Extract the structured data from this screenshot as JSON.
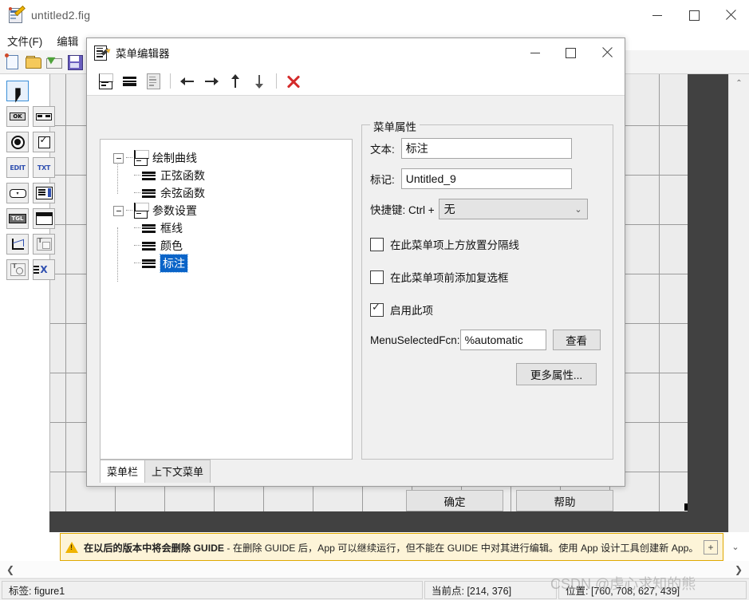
{
  "main_window": {
    "title": "untitled2.fig",
    "icon": "figure-file-icon",
    "controls": {
      "minimize": "minimize-icon",
      "maximize": "maximize-icon",
      "close": "close-icon"
    },
    "menubar": [
      "文件(F)",
      "编辑"
    ],
    "toolbar": [
      "new-icon",
      "open-icon",
      "export-icon",
      "save-icon"
    ],
    "palette": [
      {
        "name": "select-tool",
        "glyph": "arrow",
        "selected": true
      },
      {
        "name": "push-button-tool",
        "glyph": "OK"
      },
      {
        "name": "slider-tool",
        "glyph": "slider"
      },
      {
        "name": "radio-button-tool",
        "glyph": "radio"
      },
      {
        "name": "check-box-tool",
        "glyph": "check"
      },
      {
        "name": "edit-text-tool",
        "glyph": "EDIT"
      },
      {
        "name": "static-text-tool",
        "glyph": "TXT"
      },
      {
        "name": "pop-up-menu-tool",
        "glyph": "popup"
      },
      {
        "name": "listbox-tool",
        "glyph": "listbox"
      },
      {
        "name": "toggle-button-tool",
        "glyph": "TGL"
      },
      {
        "name": "table-tool",
        "glyph": "table"
      },
      {
        "name": "axes-tool",
        "glyph": "axes"
      },
      {
        "name": "panel-tool",
        "glyph": "panel"
      },
      {
        "name": "button-group-tool",
        "glyph": "buttongroup"
      },
      {
        "name": "activex-tool",
        "glyph": "ActiveX"
      }
    ]
  },
  "dialog": {
    "title": "菜单编辑器",
    "icon": "menu-editor-icon",
    "controls": {
      "minimize": "minimize-icon",
      "maximize": "maximize-icon",
      "close": "close-icon"
    },
    "toolbar": [
      {
        "name": "new-menu-button",
        "icon": "new-menu-icon"
      },
      {
        "name": "new-menu-item-button",
        "icon": "new-menu-item-icon"
      },
      {
        "name": "new-context-menu-button",
        "icon": "new-context-menu-icon"
      },
      {
        "name": "move-left-button",
        "icon": "arrow-left-icon"
      },
      {
        "name": "move-right-button",
        "icon": "arrow-right-icon"
      },
      {
        "name": "move-up-button",
        "icon": "arrow-up-icon"
      },
      {
        "name": "move-down-button",
        "icon": "arrow-down-icon"
      },
      {
        "name": "delete-button",
        "icon": "delete-x-icon"
      }
    ],
    "tree": [
      {
        "label": "绘制曲线",
        "type": "menu",
        "level": 0,
        "expanded": true,
        "selected": false
      },
      {
        "label": "正弦函数",
        "type": "item",
        "level": 1,
        "selected": false
      },
      {
        "label": "余弦函数",
        "type": "item",
        "level": 1,
        "selected": false
      },
      {
        "label": "参数设置",
        "type": "menu",
        "level": 0,
        "expanded": true,
        "selected": false
      },
      {
        "label": "框线",
        "type": "item",
        "level": 1,
        "selected": false
      },
      {
        "label": "颜色",
        "type": "item",
        "level": 1,
        "selected": false
      },
      {
        "label": "标注",
        "type": "item",
        "level": 1,
        "selected": true
      }
    ],
    "tabs": [
      {
        "label": "菜单栏",
        "active": true
      },
      {
        "label": "上下文菜单",
        "active": false
      }
    ],
    "properties": {
      "legend": "菜单属性",
      "text_label": "文本:",
      "text_value": "标注",
      "tag_label": "标记:",
      "tag_value": "Untitled_9",
      "accel_label": "快捷键: Ctrl +",
      "accel_value": "无",
      "separator_checkbox": {
        "label": "在此菜单项上方放置分隔线",
        "checked": false
      },
      "checkmark_checkbox": {
        "label": "在此菜单项前添加复选框",
        "checked": false
      },
      "enable_checkbox": {
        "label": "启用此项",
        "checked": true
      },
      "callback_label": "MenuSelectedFcn:",
      "callback_value": "%automatic",
      "view_button": "查看",
      "more_props_button": "更多属性..."
    },
    "footer": {
      "ok_button": "确定",
      "help_button": "帮助"
    }
  },
  "warning": {
    "icon": "warning-triangle-icon",
    "bold_text": "在以后的版本中将会删除 GUIDE",
    "rest_text": " - 在删除 GUIDE 后，App 可以继续运行，但不能在 GUIDE 中对其进行编辑。使用 App 设计工具创建新 App。",
    "expand_button": "+",
    "collapse_caret": "chevron-down-icon"
  },
  "scroll": {
    "left_arrow": "chevron-left-icon",
    "right_arrow": "chevron-right-icon",
    "up_arrow": "chevron-up-icon"
  },
  "statusbar": {
    "tag": "标签: figure1",
    "current_point": "当前点: [214, 376]",
    "position": "位置: [760, 708, 627, 439]"
  },
  "watermark": "CSDN @虔心求知的熊",
  "colors": {
    "selection_blue": "#0a64c8",
    "warning_border": "#e0a800",
    "warning_bg": "#fdf4d8",
    "canvas_gray": "#ececec",
    "dark_gray": "#414141"
  }
}
